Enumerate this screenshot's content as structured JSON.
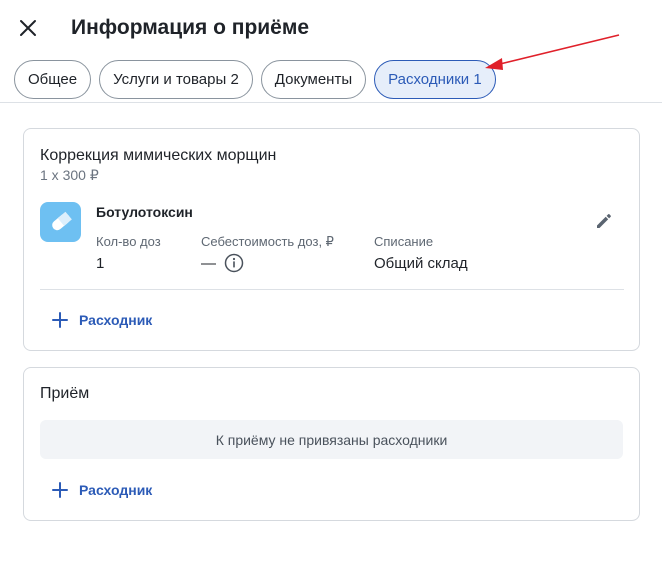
{
  "header": {
    "title": "Информация о приёме"
  },
  "tabs": [
    {
      "label": "Общее",
      "active": false
    },
    {
      "label": "Услуги и товары 2",
      "active": false
    },
    {
      "label": "Документы",
      "active": false
    },
    {
      "label": "Расходники 1",
      "active": true
    }
  ],
  "service_card": {
    "service_name": "Коррекция мимических морщин",
    "quantity_price": "1 x 300 ₽",
    "item": {
      "icon": "pill-icon",
      "name": "Ботулотоксин",
      "columns": [
        {
          "label": "Кол-во доз",
          "value": "1"
        },
        {
          "label": "Себестоимость доз, ₽",
          "value": "—"
        },
        {
          "label": "Списание",
          "value": "Общий склад"
        }
      ]
    },
    "add_label": "Расходник"
  },
  "appointment_card": {
    "title": "Приём",
    "empty_text": "К приёму не привязаны расходники",
    "add_label": "Расходник"
  },
  "colors": {
    "accent": "#2c5bb7",
    "active_tab_bg": "#e6eefa",
    "item_icon_bg": "#6ec0f2",
    "annotation_arrow": "#e0202a"
  }
}
